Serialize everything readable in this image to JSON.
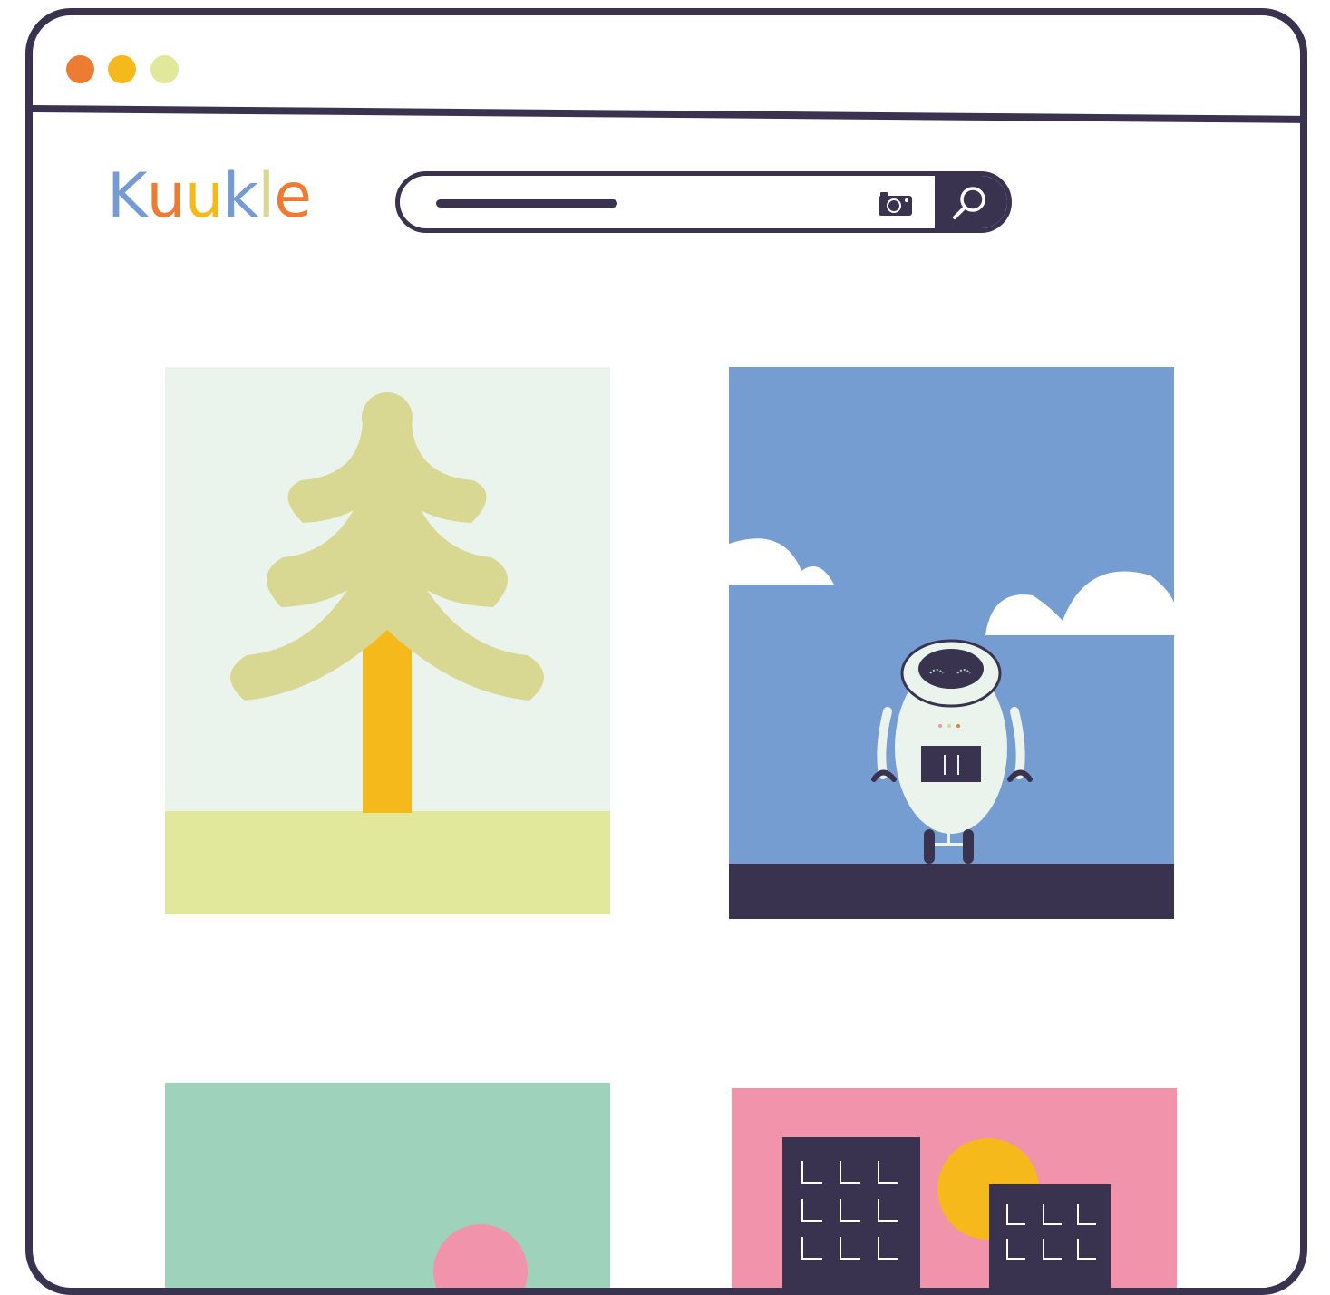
{
  "window": {
    "traffic_lights": [
      {
        "name": "close",
        "color": "#ec7c33"
      },
      {
        "name": "minimize",
        "color": "#f5b91c"
      },
      {
        "name": "maximize",
        "color": "#e1e89c"
      }
    ]
  },
  "logo": {
    "letters": [
      {
        "char": "K",
        "color": "#759cd2"
      },
      {
        "char": "u",
        "color": "#ec7c33"
      },
      {
        "char": "u",
        "color": "#f5b91c"
      },
      {
        "char": "k",
        "color": "#759cd2"
      },
      {
        "char": "l",
        "color": "#d8d893"
      },
      {
        "char": "e",
        "color": "#ec7c33"
      }
    ]
  },
  "search": {
    "query_placeholder_line": "placeholder-bar",
    "camera_icon": "camera-icon",
    "button_icon": "magnifier-icon"
  },
  "results": [
    {
      "name": "pine-tree-image",
      "icon": "tree-illustration",
      "bg": "#eaf4ec"
    },
    {
      "name": "robot-image",
      "icon": "robot-illustration",
      "bg": "#769dd2"
    },
    {
      "name": "sunset-image",
      "icon": "green-pink-illustration",
      "bg": "#9ed2bb"
    },
    {
      "name": "city-image",
      "icon": "buildings-illustration",
      "bg": "#f093ab"
    }
  ],
  "colors": {
    "frame": "#3a3350",
    "accent_orange": "#ec7c33",
    "accent_yellow": "#f5b91c",
    "accent_blue": "#759cd2",
    "accent_green": "#d8d893"
  }
}
